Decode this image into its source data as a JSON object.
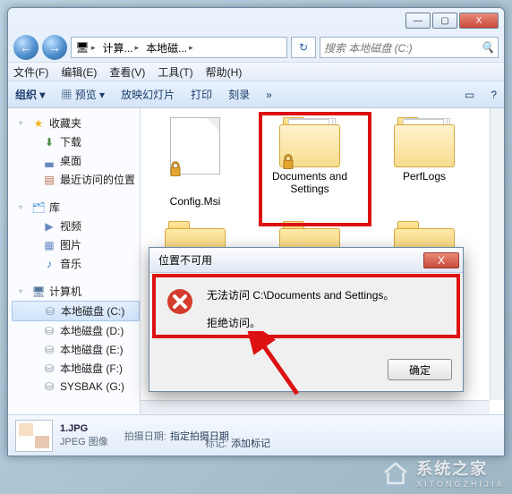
{
  "window_controls": {
    "min": "—",
    "max": "▢",
    "close": "X"
  },
  "nav": {
    "back": "←",
    "fwd": "→"
  },
  "address": {
    "root_icon": "🖥",
    "seg1": "计算...",
    "seg2": "本地磁...",
    "chevron": "▸"
  },
  "refresh": {
    "icon": "↻"
  },
  "search": {
    "placeholder": "搜索 本地磁盘 (C:)",
    "icon": "🔍"
  },
  "menubar": {
    "file": "文件(F)",
    "edit": "编辑(E)",
    "view": "查看(V)",
    "tools": "工具(T)",
    "help": "帮助(H)"
  },
  "toolbar": {
    "org": "组织 ▾",
    "preview": "预览 ▾",
    "slideshow": "放映幻灯片",
    "print": "打印",
    "burn": "刻录",
    "more": "»",
    "panes_icon": "▭",
    "help_icon": "?"
  },
  "sidebar": {
    "favorites": {
      "label": "收藏夹",
      "icon": "★"
    },
    "downloads": {
      "label": "下载",
      "icon": "⬇"
    },
    "desktop": {
      "label": "桌面",
      "icon": "▃"
    },
    "recent": {
      "label": "最近访问的位置",
      "icon": "▤"
    },
    "libraries": {
      "label": "库",
      "icon": "🗂"
    },
    "videos": {
      "label": "视频",
      "icon": "▶"
    },
    "pictures": {
      "label": "图片",
      "icon": "▦"
    },
    "music": {
      "label": "音乐",
      "icon": "♪"
    },
    "computer": {
      "label": "计算机",
      "icon": "🖥"
    },
    "drv_c": {
      "label": "本地磁盘 (C:)",
      "icon": "⛁"
    },
    "drv_d": {
      "label": "本地磁盘 (D:)",
      "icon": "⛁"
    },
    "drv_e": {
      "label": "本地磁盘 (E:)",
      "icon": "⛁"
    },
    "drv_f": {
      "label": "本地磁盘 (F:)",
      "icon": "⛁"
    },
    "drv_g": {
      "label": "SYSBAK (G:)",
      "icon": "⛁"
    }
  },
  "items": {
    "0": {
      "label": "Config.Msi"
    },
    "1": {
      "label": "Documents and Settings"
    },
    "2": {
      "label": "PerfLogs"
    }
  },
  "dialog": {
    "title": "位置不可用",
    "line1": "无法访问 C:\\Documents and Settings。",
    "line2": "拒绝访问。",
    "ok": "确定",
    "close": "X"
  },
  "status": {
    "file": "1.JPG",
    "type": "JPEG 图像",
    "shot_k": "拍摄日期:",
    "shot_v": "指定拍摄日期",
    "tag_k": "标记:",
    "tag_v": "添加标记"
  },
  "watermark": {
    "brand": "系统之家",
    "sub": "XITONGZHIJIA"
  }
}
